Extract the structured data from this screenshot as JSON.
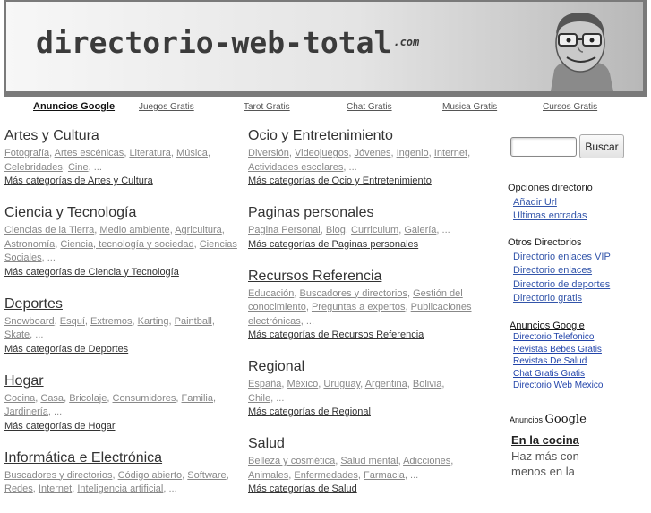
{
  "header": {
    "logo_main": "directorio-web-total",
    "logo_suffix": ".com"
  },
  "googlebar": {
    "title": "Anuncios Google",
    "links": [
      "Juegos Gratis",
      "Tarot Gratis",
      "Chat Gratis",
      "Musica Gratis",
      "Cursos Gratis"
    ]
  },
  "columns": [
    [
      {
        "title": "Artes y Cultura",
        "subs": [
          "Fotografía",
          "Artes escénicas",
          "Literatura",
          "Música",
          "Celebridades",
          "Cine"
        ],
        "more": "Más categorías de Artes y Cultura"
      },
      {
        "title": "Ciencia y Tecnología",
        "subs": [
          "Ciencias de la Tierra",
          "Medio ambiente",
          "Agricultura",
          "Astronomía",
          "Ciencia, tecnología y sociedad",
          "Ciencias Sociales"
        ],
        "more": "Más categorías de Ciencia y Tecnología"
      },
      {
        "title": "Deportes",
        "subs": [
          "Snowboard",
          "Esquí",
          "Extremos",
          "Karting",
          "Paintball",
          "Skate"
        ],
        "more": "Más categorías de Deportes"
      },
      {
        "title": "Hogar",
        "subs": [
          "Cocina",
          "Casa",
          "Bricolaje",
          "Consumidores",
          "Familia",
          "Jardinería"
        ],
        "more": "Más categorías de Hogar"
      },
      {
        "title": "Informática e Electrónica",
        "subs": [
          "Buscadores y directorios",
          "Código abierto",
          "Software",
          "Redes",
          "Internet",
          "Inteligencia artificial"
        ],
        "more": ""
      }
    ],
    [
      {
        "title": "Ocio y Entretenimiento",
        "subs": [
          "Diversión",
          "Videojuegos",
          "Jóvenes",
          "Ingenio",
          "Internet",
          "Actividades escolares"
        ],
        "more": "Más categorías de Ocio y Entretenimiento"
      },
      {
        "title": "Paginas personales",
        "subs": [
          "Pagina Personal",
          "Blog",
          "Curriculum",
          "Galería"
        ],
        "more": "Más categorías de Paginas personales"
      },
      {
        "title": "Recursos Referencia",
        "subs": [
          "Educación",
          "Buscadores y directorios",
          "Gestión del conocimiento",
          "Preguntas a expertos",
          "Publicaciones electrónicas"
        ],
        "more": "Más categorías de Recursos Referencia"
      },
      {
        "title": "Regional",
        "subs": [
          "España",
          "México",
          "Uruguay",
          "Argentina",
          "Bolivia",
          "Chile"
        ],
        "more": "Más categorías de Regional"
      },
      {
        "title": "Salud",
        "subs": [
          "Belleza y cosmética",
          "Salud mental",
          "Adicciones",
          "Animales",
          "Enfermedades",
          "Farmacia"
        ],
        "more": "Más categorías de Salud"
      }
    ]
  ],
  "ellipsis": "...",
  "search": {
    "button": "Buscar",
    "value": ""
  },
  "sidebar": {
    "options_title": "Opciones directorio",
    "options": [
      "Añadir Url",
      "Ultimas entradas"
    ],
    "others_title": "Otros Directorios",
    "others": [
      "Directorio enlaces VIP",
      "Directorio enlaces",
      "Directorio de deportes",
      "Directorio gratis"
    ]
  },
  "adbox": {
    "title": "Anuncios Google",
    "links": [
      "Directorio Telefonico",
      "Revistas Bebes Gratis",
      "Revistas De Salud",
      "Chat Gratis Gratis",
      "Directorio Web Mexico"
    ]
  },
  "adbox2": {
    "prefix": "Anuncios",
    "brand": "Google",
    "headline": "En la cocina",
    "body": [
      "Haz más con",
      "menos en la"
    ]
  }
}
